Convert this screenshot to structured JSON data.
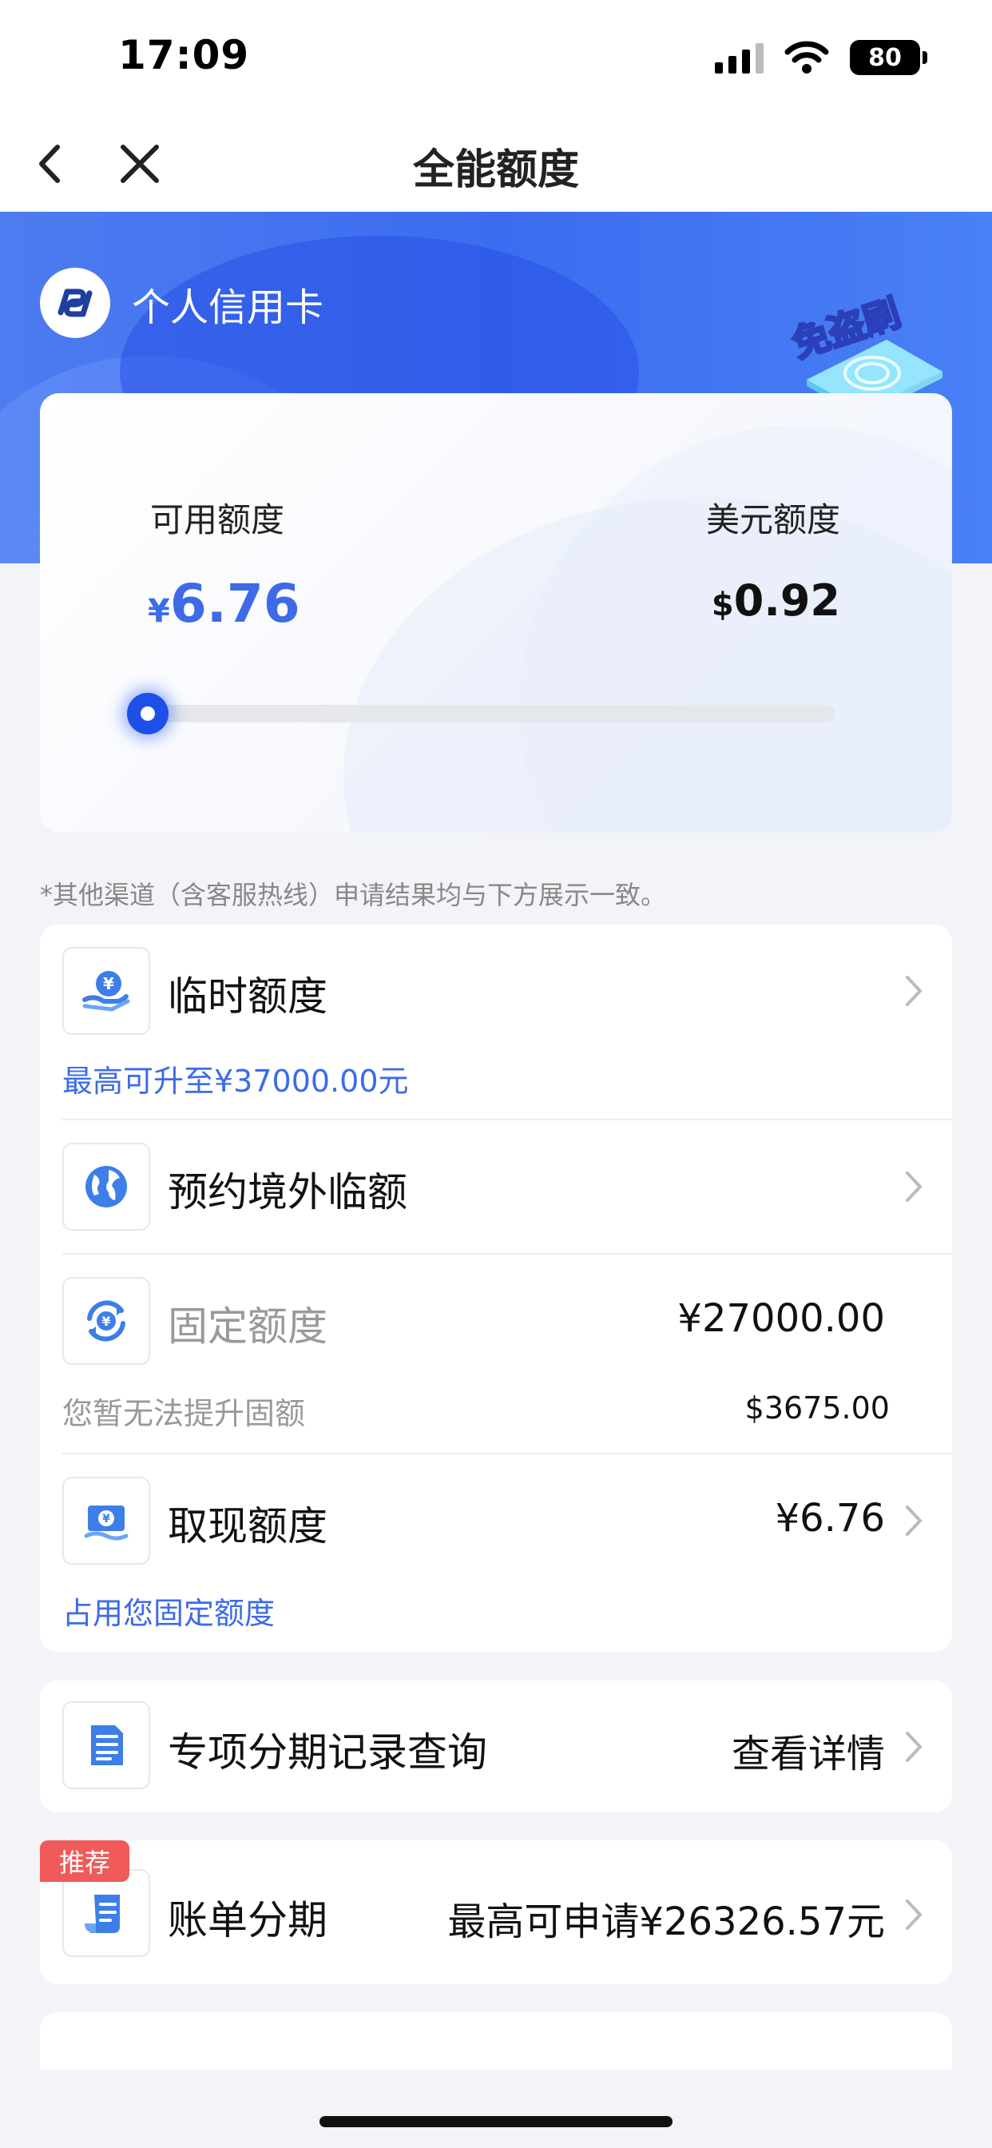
{
  "status_bar": {
    "time": "17:09",
    "battery": "80"
  },
  "nav": {
    "title": "全能额度"
  },
  "header": {
    "bank_name": "个人信用卡",
    "badge_text": "免盗刷"
  },
  "credit": {
    "available_label": "可用额度",
    "available_currency": "¥",
    "available_amount": "6.76",
    "usd_label": "美元额度",
    "usd_currency": "$",
    "usd_amount": "0.92",
    "usage_fraction": 0.0
  },
  "note": "*其他渠道（含客服热线）申请结果均与下方展示一致。",
  "items": {
    "temp_limit": {
      "title": "临时额度",
      "sub": "最高可升至¥37000.00元"
    },
    "overseas": {
      "title": "预约境外临额"
    },
    "fixed": {
      "title": "固定额度",
      "value": "¥27000.00",
      "sub": "您暂无法提升固额",
      "sub_value": "$3675.00"
    },
    "cash": {
      "title": "取现额度",
      "value": "¥6.76",
      "sub": "占用您固定额度"
    },
    "installment_records": {
      "title": "专项分期记录查询",
      "value": "查看详情"
    },
    "bill_installment": {
      "tag": "推荐",
      "title": "账单分期",
      "value": "最高可申请¥26326.57元"
    }
  },
  "colors": {
    "accent": "#3d6be8",
    "tag": "#f05a5a"
  }
}
